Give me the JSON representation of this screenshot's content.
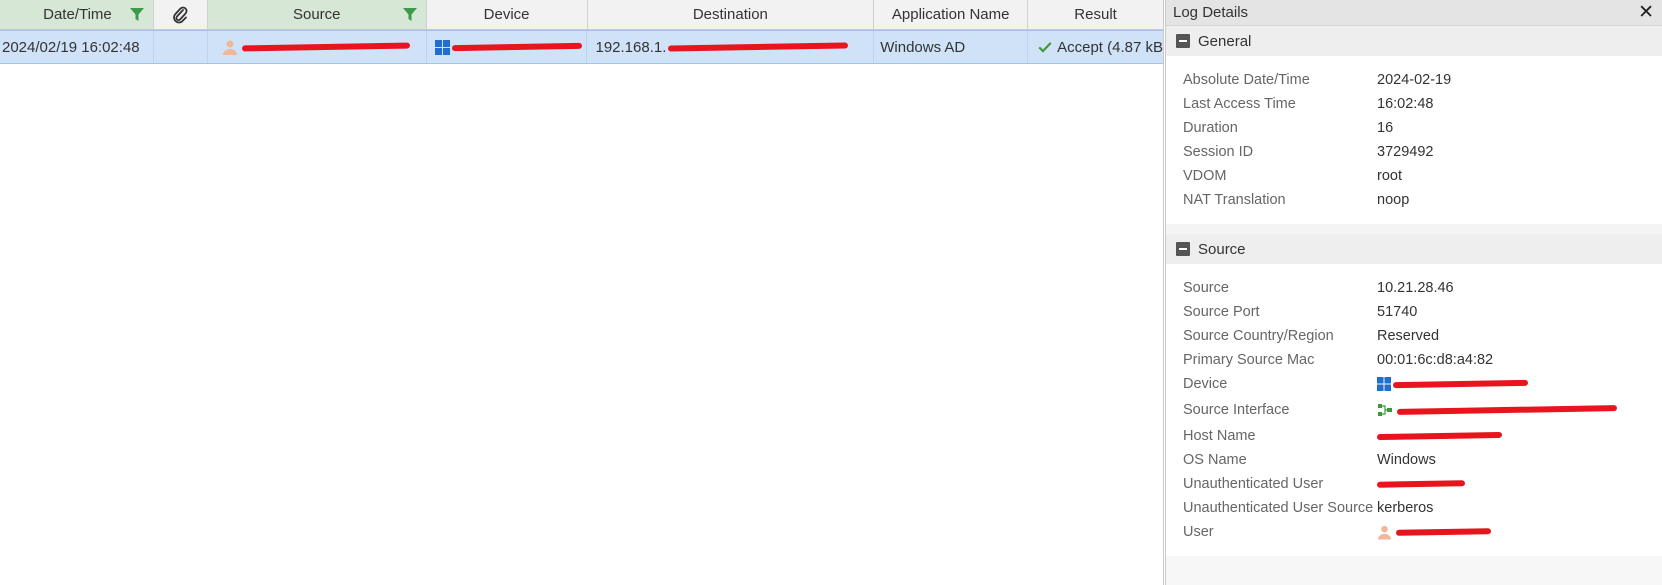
{
  "table": {
    "columns": {
      "datetime": "Date/Time",
      "source": "Source",
      "device": "Device",
      "destination": "Destination",
      "application": "Application Name",
      "result": "Result"
    },
    "row": {
      "datetime": "2024/02/19 16:02:48",
      "destination": "192.168.1.",
      "application": "Windows AD",
      "result": "Accept (4.87 kB"
    }
  },
  "details": {
    "title": "Log Details",
    "close": "✕",
    "general": {
      "title": "General",
      "rows": [
        {
          "k": "Absolute Date/Time",
          "v": "2024-02-19"
        },
        {
          "k": "Last Access Time",
          "v": "16:02:48"
        },
        {
          "k": "Duration",
          "v": "16"
        },
        {
          "k": "Session ID",
          "v": "3729492"
        },
        {
          "k": "VDOM",
          "v": "root"
        },
        {
          "k": "NAT Translation",
          "v": "noop"
        }
      ]
    },
    "source": {
      "title": "Source",
      "rows": [
        {
          "k": "Source",
          "v": "10.21.28.46"
        },
        {
          "k": "Source Port",
          "v": "51740"
        },
        {
          "k": "Source Country/Region",
          "v": "Reserved"
        },
        {
          "k": "Primary Source Mac",
          "v": "00:01:6c:d8:a4:82"
        }
      ],
      "device_label": "Device",
      "interface_label": "Source Interface",
      "hostname_label": "Host Name",
      "os_label": "OS Name",
      "os_value": "Windows",
      "unauth_user_label": "Unauthenticated User",
      "unauth_source_label": "Unauthenticated User Source",
      "unauth_source_value": "kerberos",
      "user_label": "User"
    }
  },
  "colors": {
    "selected_row": "#cfe2f8",
    "filter_active": "#d6e7d6",
    "redaction": "#e8141e",
    "accept": "#3a9a3a",
    "windows": "#1f6fd1"
  }
}
